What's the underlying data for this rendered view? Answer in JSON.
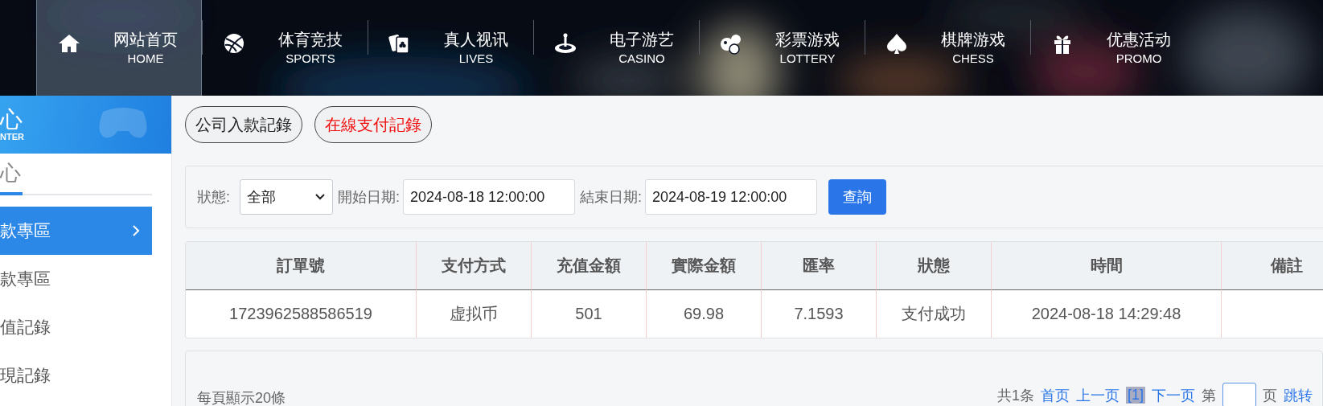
{
  "nav": {
    "items": [
      {
        "label": "网站首页",
        "sublabel": "HOME",
        "selected": true
      },
      {
        "label": "体育竞技",
        "sublabel": "SPORTS",
        "selected": false
      },
      {
        "label": "真人视讯",
        "sublabel": "LIVES",
        "selected": false
      },
      {
        "label": "电子游艺",
        "sublabel": "CASINO",
        "selected": false
      },
      {
        "label": "彩票游戏",
        "sublabel": "LOTTERY",
        "selected": false
      },
      {
        "label": "棋牌游戏",
        "sublabel": "CHESS",
        "selected": false
      },
      {
        "label": "优惠活动",
        "sublabel": "PROMO",
        "selected": false
      }
    ]
  },
  "sidebar": {
    "header": {
      "title": "心",
      "subtitle": "NTER"
    },
    "tab": {
      "label": "心",
      "selected": true
    },
    "items": [
      {
        "label": "款專區",
        "selected": true
      },
      {
        "label": "款專區",
        "selected": false
      },
      {
        "label": "值記錄",
        "selected": false
      },
      {
        "label": "現記錄",
        "selected": false
      }
    ]
  },
  "record_tabs": [
    {
      "label": "公司入款記錄",
      "selected": false
    },
    {
      "label": "在線支付記錄",
      "selected": true
    }
  ],
  "filter": {
    "status_label": "狀態:",
    "status_value": "全部",
    "start_label": "開始日期:",
    "start_value": "2024-08-18 12:00:00",
    "end_label": "結束日期:",
    "end_value": "2024-08-19 12:00:00",
    "query_button": "查詢"
  },
  "table": {
    "columns": [
      "訂單號",
      "支付方式",
      "充值金額",
      "實際金額",
      "匯率",
      "狀態",
      "時間",
      "備註"
    ],
    "rows": [
      [
        "1723962588586519",
        "虚拟币",
        "501",
        "69.98",
        "7.1593",
        "支付成功",
        "2024-08-18 14:29:48",
        null
      ]
    ]
  },
  "pagination": {
    "page_size_text": "每頁顯示20條",
    "total": "共1条",
    "first": "首页",
    "prev": "上一页",
    "current": "[1]",
    "next": "下一页",
    "page_prefix": "第",
    "page_suffix": "页",
    "jump": "跳转"
  }
}
